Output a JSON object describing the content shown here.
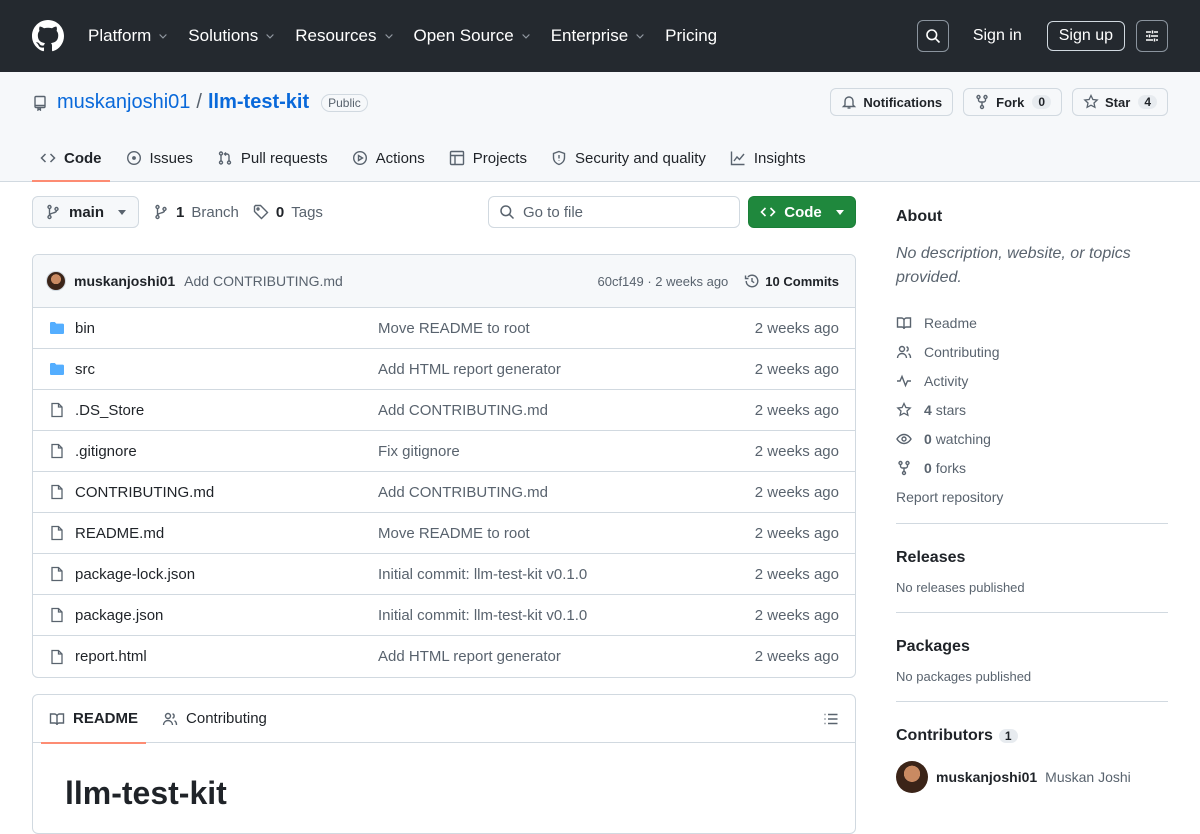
{
  "header": {
    "nav": [
      "Platform",
      "Solutions",
      "Resources",
      "Open Source",
      "Enterprise",
      "Pricing"
    ],
    "nav_has_chevron": [
      true,
      true,
      true,
      true,
      true,
      false
    ],
    "sign_in": "Sign in",
    "sign_up": "Sign up"
  },
  "repo": {
    "owner": "muskanjoshi01",
    "separator": "/",
    "name": "llm-test-kit",
    "visibility": "Public",
    "actions": {
      "notifications": "Notifications",
      "fork": "Fork",
      "fork_count": "0",
      "star": "Star",
      "star_count": "4"
    },
    "tabs": [
      "Code",
      "Issues",
      "Pull requests",
      "Actions",
      "Projects",
      "Security and quality",
      "Insights"
    ],
    "tab_icons": [
      "code-icon",
      "issue-icon",
      "pull-request-icon",
      "play-icon",
      "table-icon",
      "shield-icon",
      "graph-icon"
    ],
    "active_tab": "Code"
  },
  "toolbar": {
    "branch": "main",
    "branch_count": "1",
    "branch_label": "Branch",
    "tag_count": "0",
    "tag_label": "Tags",
    "goto_placeholder": "Go to file",
    "code_button": "Code"
  },
  "commit": {
    "author": "muskanjoshi01",
    "message": "Add CONTRIBUTING.md",
    "hash_age": "60cf149 · 2 weeks ago",
    "commits_label": "10 Commits"
  },
  "files": [
    {
      "type": "dir",
      "name": "bin",
      "message": "Move README to root",
      "age": "2 weeks ago"
    },
    {
      "type": "dir",
      "name": "src",
      "message": "Add HTML report generator",
      "age": "2 weeks ago"
    },
    {
      "type": "file",
      "name": ".DS_Store",
      "message": "Add CONTRIBUTING.md",
      "age": "2 weeks ago"
    },
    {
      "type": "file",
      "name": ".gitignore",
      "message": "Fix gitignore",
      "age": "2 weeks ago"
    },
    {
      "type": "file",
      "name": "CONTRIBUTING.md",
      "message": "Add CONTRIBUTING.md",
      "age": "2 weeks ago"
    },
    {
      "type": "file",
      "name": "README.md",
      "message": "Move README to root",
      "age": "2 weeks ago"
    },
    {
      "type": "file",
      "name": "package-lock.json",
      "message": "Initial commit: llm-test-kit v0.1.0",
      "age": "2 weeks ago"
    },
    {
      "type": "file",
      "name": "package.json",
      "message": "Initial commit: llm-test-kit v0.1.0",
      "age": "2 weeks ago"
    },
    {
      "type": "file",
      "name": "report.html",
      "message": "Add HTML report generator",
      "age": "2 weeks ago"
    }
  ],
  "readme": {
    "tab_readme": "README",
    "tab_contributing": "Contributing",
    "heading": "llm-test-kit"
  },
  "sidebar": {
    "about_title": "About",
    "about_desc": "No description, website, or topics provided.",
    "readme": "Readme",
    "contributing": "Contributing",
    "activity": "Activity",
    "stars_count": "4",
    "stars_label": "stars",
    "watching_count": "0",
    "watching_label": "watching",
    "forks_count": "0",
    "forks_label": "forks",
    "report": "Report repository",
    "releases_title": "Releases",
    "releases_sub": "No releases published",
    "packages_title": "Packages",
    "packages_sub": "No packages published",
    "contributors_title": "Contributors",
    "contributors_count": "1",
    "contributor_login": "muskanjoshi01",
    "contributor_name": "Muskan Joshi"
  },
  "colors": {
    "header_bg": "#24292f",
    "link": "#0969da",
    "green": "#1f883d",
    "folder": "#54aeff",
    "tab_underline": "#fd8c73"
  }
}
